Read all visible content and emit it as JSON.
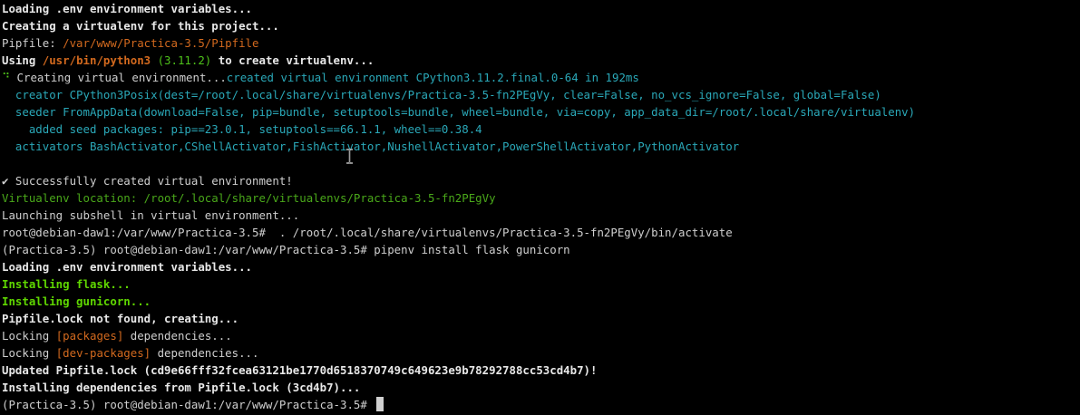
{
  "terminal": {
    "lines": {
      "l01": "Loading .env environment variables...",
      "l02": "Creating a virtualenv for this project...",
      "l03_label": "Pipfile: ",
      "l03_path": "/var/www/Practica-3.5/Pipfile",
      "l04_a": "Using ",
      "l04_path": "/usr/bin/python3",
      "l04_ver": "(3.11.2)",
      "l04_b": " to create virtualenv...",
      "l05_spinner": "⠙",
      "l05_a": " Creating virtual environment...",
      "l05_b": "created virtual environment CPython3.11.2.final.0-64 in 192ms",
      "l06": "  creator CPython3Posix(dest=/root/.local/share/virtualenvs/Practica-3.5-fn2PEgVy, clear=False, no_vcs_ignore=False, global=False)",
      "l07": "  seeder FromAppData(download=False, pip=bundle, setuptools=bundle, wheel=bundle, via=copy, app_data_dir=/root/.local/share/virtualenv)",
      "l08": "    added seed packages: pip==23.0.1, setuptools==66.1.1, wheel==0.38.4",
      "l09": "  activators BashActivator,CShellActivator,FishActivator,NushellActivator,PowerShellActivator,PythonActivator",
      "l10": "",
      "l11": "✔ Successfully created virtual environment!",
      "l12": "Virtualenv location: /root/.local/share/virtualenvs/Practica-3.5-fn2PEgVy",
      "l13": "Launching subshell in virtual environment...",
      "l14": "root@debian-daw1:/var/www/Practica-3.5#  . /root/.local/share/virtualenvs/Practica-3.5-fn2PEgVy/bin/activate",
      "l15": "(Practica-3.5) root@debian-daw1:/var/www/Practica-3.5# pipenv install flask gunicorn",
      "l16": "Loading .env environment variables...",
      "l17": "Installing flask...",
      "l18": "Installing gunicorn...",
      "l19": "Pipfile.lock not found, creating...",
      "l20_a": "Locking ",
      "l20_b": "[packages]",
      "l20_c": " dependencies...",
      "l21_a": "Locking ",
      "l21_b": "[dev-packages]",
      "l21_c": " dependencies...",
      "l22": "Updated Pipfile.lock (cd9e66fff32fcea63121be1770d6518370749c649623e9b78292788cc53cd4b7)!",
      "l23": "Installing dependencies from Pipfile.lock (3cd4b7)...",
      "l24": "(Practica-3.5) root@debian-daw1:/var/www/Practica-3.5# "
    }
  },
  "colors": {
    "background": "#000000",
    "default_text": "#cfcfcf",
    "path_orange": "#d2691e",
    "success_green": "#4ec21a",
    "info_teal": "#2aa8b8"
  },
  "icons": {
    "spinner": "spinner-icon",
    "checkmark": "checkmark-icon",
    "mouse_pointer": "text-cursor-icon"
  }
}
